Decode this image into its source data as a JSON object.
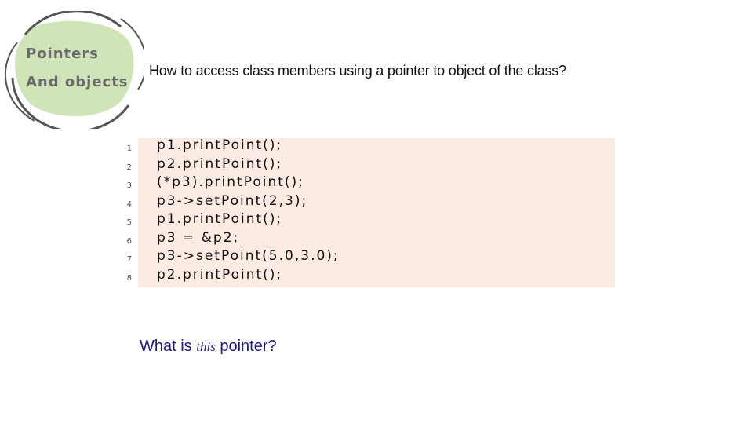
{
  "logo": {
    "line1": "Pointers",
    "line2": "And objects",
    "green": "#cfe5b8",
    "ring": "#555555"
  },
  "question": "How to access class members using a pointer to object of the  class?",
  "code": {
    "line_numbers": [
      "1",
      "2",
      "3",
      "4",
      "5",
      "6",
      "7",
      "8"
    ],
    "lines": [
      "p1.printPoint();",
      "p2.printPoint();",
      "(*p3).printPoint();",
      "p3->setPoint(2,3);",
      "p1.printPoint();",
      "p3 = &p2;",
      "p3->setPoint(5.0,3.0);",
      "p2.printPoint();"
    ],
    "background": "#fcebe3"
  },
  "footer": {
    "before": "What is ",
    "keyword": "this",
    "after": " pointer?"
  }
}
